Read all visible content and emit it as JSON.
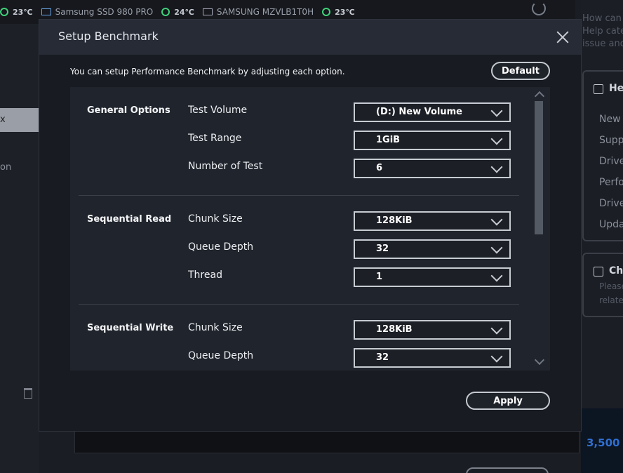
{
  "topbar": {
    "temp1": "23℃",
    "device1": "Samsung SSD 980 PRO",
    "temp2": "24℃",
    "device2": "SAMSUNG MZVLB1T0H",
    "temp3": "23℃"
  },
  "background": {
    "left_active_text": "x",
    "left_text": "on",
    "right_help": [
      "How can",
      "Help cate",
      "issue and"
    ],
    "card1_title": "He",
    "card1_items": [
      "New I",
      "Suppo",
      "Drive",
      "Perfo",
      "Drive",
      "Upda"
    ],
    "card2_title": "Cha",
    "card2_lines": [
      "Please",
      "relate"
    ],
    "promo_text": "3,500"
  },
  "dialog": {
    "title": "Setup Benchmark",
    "description": "You can setup Performance Benchmark by adjusting each option.",
    "default_label": "Default",
    "apply_label": "Apply",
    "sections": {
      "general": {
        "title": "General Options",
        "test_volume_label": "Test Volume",
        "test_volume_value": "(D:) New Volume",
        "test_range_label": "Test Range",
        "test_range_value": "1GiB",
        "number_of_test_label": "Number of Test",
        "number_of_test_value": "6"
      },
      "seq_read": {
        "title": "Sequential Read",
        "chunk_size_label": "Chunk Size",
        "chunk_size_value": "128KiB",
        "queue_depth_label": "Queue Depth",
        "queue_depth_value": "32",
        "thread_label": "Thread",
        "thread_value": "1"
      },
      "seq_write": {
        "title": "Sequential Write",
        "chunk_size_label": "Chunk Size",
        "chunk_size_value": "128KiB",
        "queue_depth_label": "Queue Depth",
        "queue_depth_value": "32"
      }
    }
  },
  "colors": {
    "dialog_bg": "#181b21",
    "panel_bg": "#20242c",
    "accent_green": "#3fd27a",
    "border": "#c7cbd2"
  }
}
